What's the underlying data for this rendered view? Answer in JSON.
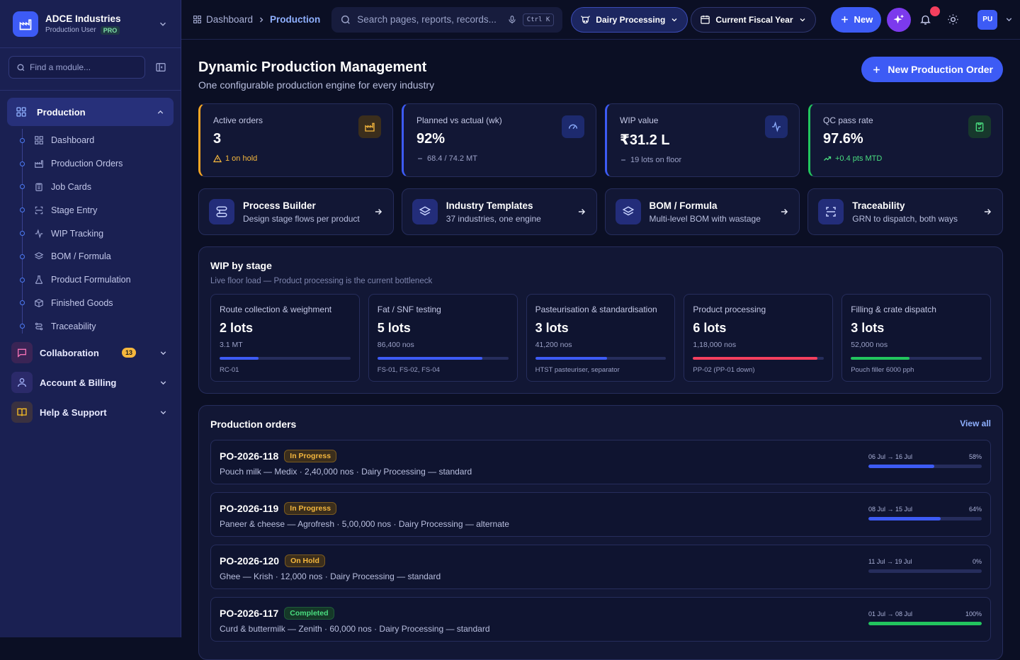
{
  "brand": {
    "name": "ADCE Industries",
    "role": "Production User",
    "plan": "PRO"
  },
  "sidebar": {
    "find_placeholder": "Find a module...",
    "production_group": "Production",
    "items": [
      {
        "label": "Dashboard",
        "icon": "grid-icon"
      },
      {
        "label": "Production Orders",
        "icon": "factory-icon"
      },
      {
        "label": "Job Cards",
        "icon": "clipboard-icon"
      },
      {
        "label": "Stage Entry",
        "icon": "scan-icon"
      },
      {
        "label": "WIP Tracking",
        "icon": "activity-icon"
      },
      {
        "label": "BOM / Formula",
        "icon": "layers-icon"
      },
      {
        "label": "Product Formulation",
        "icon": "flask-icon"
      },
      {
        "label": "Finished Goods",
        "icon": "package-icon"
      },
      {
        "label": "Traceability",
        "icon": "route-icon"
      }
    ],
    "sections": [
      {
        "label": "Collaboration",
        "badge": "13"
      },
      {
        "label": "Account & Billing"
      },
      {
        "label": "Help & Support"
      }
    ]
  },
  "topbar": {
    "breadcrumb_root": "Dashboard",
    "breadcrumb_current": "Production",
    "search_placeholder": "Search pages, reports, records...",
    "shortcut": "Ctrl K",
    "industry": "Dairy Processing",
    "period": "Current Fiscal Year",
    "new_label": "New",
    "avatar": "PU"
  },
  "page": {
    "title": "Dynamic Production Management",
    "subtitle": "One configurable production engine for every industry",
    "cta": "New Production Order"
  },
  "kpis": [
    {
      "label": "Active orders",
      "value": "3",
      "sub": "1 on hold",
      "accent": "#f5a524"
    },
    {
      "label": "Planned vs actual (wk)",
      "value": "92%",
      "sub": "68.4 / 74.2 MT",
      "accent": "#3d5bf5"
    },
    {
      "label": "WIP value",
      "value": "₹31.2 L",
      "sub": "19 lots on floor",
      "accent": "#3d5bf5"
    },
    {
      "label": "QC pass rate",
      "value": "97.6%",
      "sub": "+0.4 pts MTD",
      "accent": "#22c55e"
    }
  ],
  "actions": [
    {
      "title": "Process Builder",
      "desc": "Design stage flows per product"
    },
    {
      "title": "Industry Templates",
      "desc": "37 industries, one engine"
    },
    {
      "title": "BOM / Formula",
      "desc": "Multi-level BOM with wastage"
    },
    {
      "title": "Traceability",
      "desc": "GRN to dispatch, both ways"
    }
  ],
  "wip": {
    "title": "WIP by stage",
    "subtitle": "Live floor load — Product processing is the current bottleneck",
    "stages": [
      {
        "name": "Route collection & weighment",
        "lots": "2 lots",
        "qty": "3.1 MT",
        "resource": "RC-01",
        "load": 0.3,
        "color": "#3d5bf5"
      },
      {
        "name": "Fat / SNF testing",
        "lots": "5 lots",
        "qty": "86,400 nos",
        "resource": "FS-01, FS-02, FS-04",
        "load": 0.8,
        "color": "#3d5bf5"
      },
      {
        "name": "Pasteurisation & standardisation",
        "lots": "3 lots",
        "qty": "41,200 nos",
        "resource": "HTST pasteuriser, separator",
        "load": 0.55,
        "color": "#3d5bf5"
      },
      {
        "name": "Product processing",
        "lots": "6 lots",
        "qty": "1,18,000 nos",
        "resource": "PP-02 (PP-01 down)",
        "load": 0.95,
        "color": "#f43f5e"
      },
      {
        "name": "Filling & crate dispatch",
        "lots": "3 lots",
        "qty": "52,000 nos",
        "resource": "Pouch filler 6000 pph",
        "load": 0.45,
        "color": "#22c55e"
      }
    ]
  },
  "orders": {
    "title": "Production orders",
    "view_all": "View all",
    "rows": [
      {
        "id": "PO-2026-118",
        "status": "In Progress",
        "desc": "Pouch milk — Medix · 2,40,000 nos · Dairy Processing — standard",
        "dates": "06 Jul → 16 Jul",
        "pct_label": "58%",
        "pct": 0.58
      },
      {
        "id": "PO-2026-119",
        "status": "In Progress",
        "desc": "Paneer & cheese — Agrofresh · 5,00,000 nos · Dairy Processing — alternate",
        "dates": "08 Jul → 15 Jul",
        "pct_label": "64%",
        "pct": 0.64
      },
      {
        "id": "PO-2026-120",
        "status": "On Hold",
        "desc": "Ghee — Krish · 12,000 nos · Dairy Processing — standard",
        "dates": "11 Jul → 19 Jul",
        "pct_label": "0%",
        "pct": 0
      },
      {
        "id": "PO-2026-117",
        "status": "Completed",
        "desc": "Curd & buttermilk — Zenith · 60,000 nos · Dairy Processing — standard",
        "dates": "01 Jul → 08 Jul",
        "pct_label": "100%",
        "pct": 1.0
      }
    ]
  }
}
